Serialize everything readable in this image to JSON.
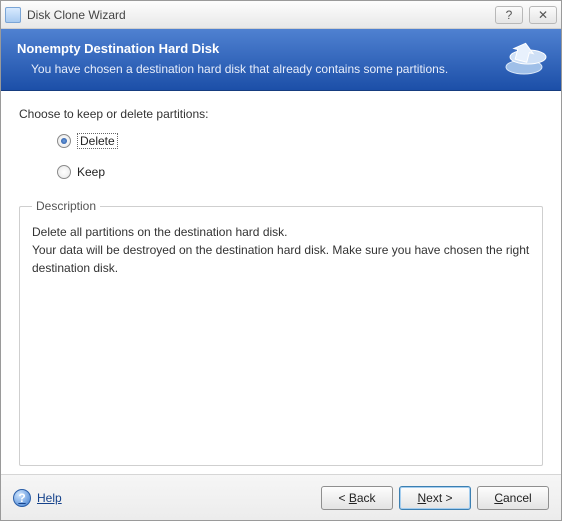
{
  "window": {
    "title": "Disk Clone Wizard"
  },
  "banner": {
    "title": "Nonempty Destination Hard Disk",
    "subtitle": "You have chosen a destination hard disk that already contains some partitions."
  },
  "body": {
    "prompt": "Choose to keep or delete partitions:",
    "option_delete": "Delete",
    "option_keep": "Keep",
    "selected": "delete",
    "description_legend": "Description",
    "description_line1": "Delete all partitions on the destination hard disk.",
    "description_line2": "Your data will be destroyed on the destination hard disk. Make sure you have chosen the right destination disk."
  },
  "footer": {
    "help": "Help",
    "back": "Back",
    "next": "Next",
    "cancel": "Cancel"
  }
}
